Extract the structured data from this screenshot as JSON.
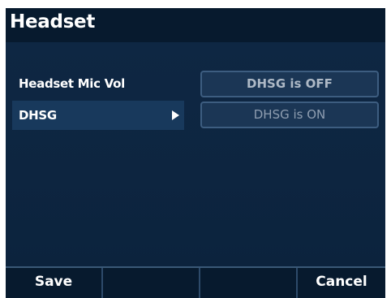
{
  "header": {
    "title": "Headset"
  },
  "settings": [
    {
      "label": "Headset Mic Vol",
      "value": "DHSG is OFF",
      "selected": false
    },
    {
      "label": "DHSG",
      "value": "DHSG is ON",
      "selected": true
    }
  ],
  "softkeys": [
    "Save",
    "",
    "",
    "Cancel"
  ],
  "colors": {
    "background": "#0f2945",
    "titlebar": "#071a2e",
    "selection": "#18395c",
    "field_border": "#3d5d80"
  }
}
